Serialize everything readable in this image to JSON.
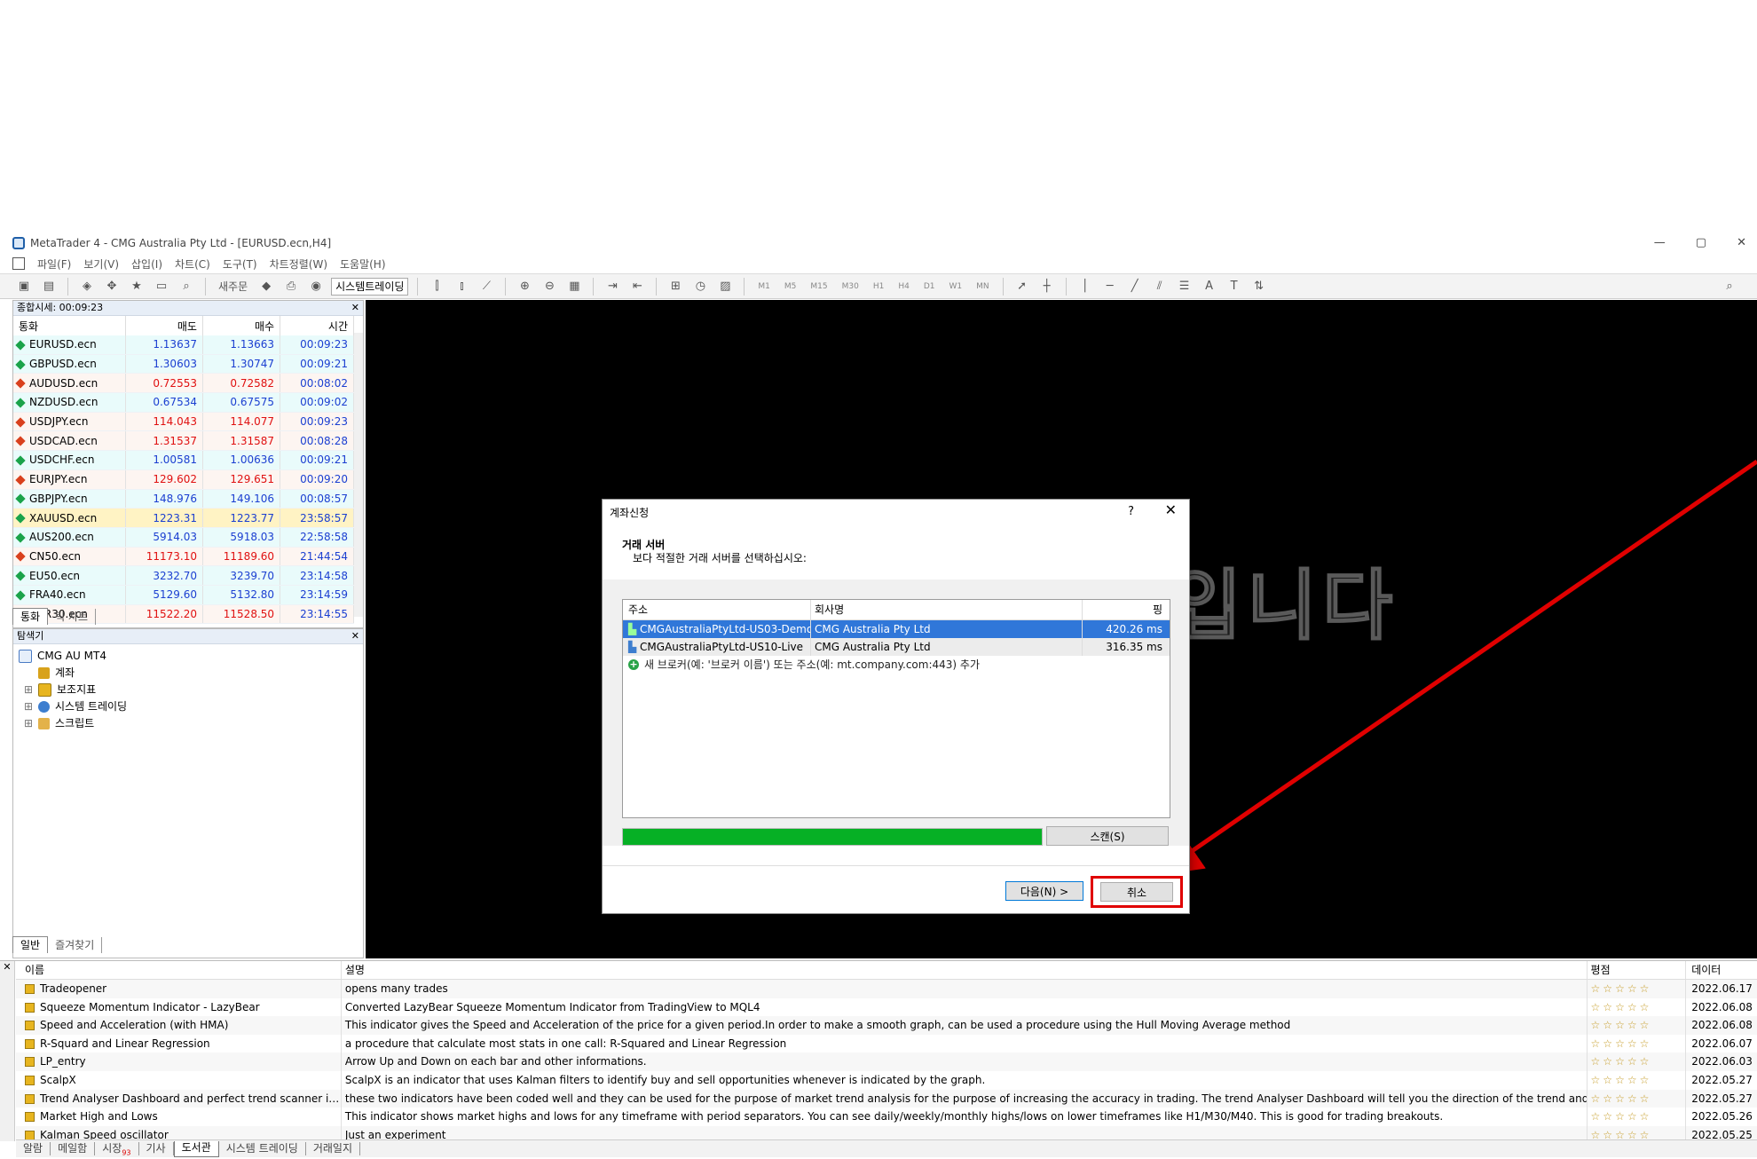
{
  "window": {
    "title": "MetaTrader 4 - CMG Australia Pty Ltd - [EURUSD.ecn,H4]",
    "controls": [
      "—",
      "▢",
      "✕"
    ]
  },
  "menu": [
    "파일(F)",
    "보기(V)",
    "삽입(I)",
    "차트(C)",
    "도구(T)",
    "차트정렬(W)",
    "도움말(H)"
  ],
  "toolbar": {
    "new_order": "새주문",
    "auto_trading": "시스템트레이딩",
    "timeframes": [
      "M1",
      "M5",
      "M15",
      "M30",
      "H1",
      "H4",
      "D1",
      "W1",
      "MN"
    ]
  },
  "market_watch": {
    "header": "종합시세: 00:09:23",
    "columns": [
      "통화",
      "매도",
      "매수",
      "시간"
    ],
    "rows": [
      {
        "symbol": "EURUSD.ecn",
        "bid": "1.13637",
        "ask": "1.13663",
        "time": "00:09:23",
        "dir": "up"
      },
      {
        "symbol": "GBPUSD.ecn",
        "bid": "1.30603",
        "ask": "1.30747",
        "time": "00:09:21",
        "dir": "up"
      },
      {
        "symbol": "AUDUSD.ecn",
        "bid": "0.72553",
        "ask": "0.72582",
        "time": "00:08:02",
        "dir": "down"
      },
      {
        "symbol": "NZDUSD.ecn",
        "bid": "0.67534",
        "ask": "0.67575",
        "time": "00:09:02",
        "dir": "up"
      },
      {
        "symbol": "USDJPY.ecn",
        "bid": "114.043",
        "ask": "114.077",
        "time": "00:09:23",
        "dir": "down"
      },
      {
        "symbol": "USDCAD.ecn",
        "bid": "1.31537",
        "ask": "1.31587",
        "time": "00:08:28",
        "dir": "down"
      },
      {
        "symbol": "USDCHF.ecn",
        "bid": "1.00581",
        "ask": "1.00636",
        "time": "00:09:21",
        "dir": "up"
      },
      {
        "symbol": "EURJPY.ecn",
        "bid": "129.602",
        "ask": "129.651",
        "time": "00:09:20",
        "dir": "down"
      },
      {
        "symbol": "GBPJPY.ecn",
        "bid": "148.976",
        "ask": "149.106",
        "time": "00:08:57",
        "dir": "up"
      },
      {
        "symbol": "XAUUSD.ecn",
        "bid": "1223.31",
        "ask": "1223.77",
        "time": "23:58:57",
        "dir": "hl"
      },
      {
        "symbol": "AUS200.ecn",
        "bid": "5914.03",
        "ask": "5918.03",
        "time": "22:58:58",
        "dir": "up"
      },
      {
        "symbol": "CN50.ecn",
        "bid": "11173.10",
        "ask": "11189.60",
        "time": "21:44:54",
        "dir": "down"
      },
      {
        "symbol": "EU50.ecn",
        "bid": "3232.70",
        "ask": "3239.70",
        "time": "23:14:58",
        "dir": "up"
      },
      {
        "symbol": "FRA40.ecn",
        "bid": "5129.60",
        "ask": "5132.80",
        "time": "23:14:59",
        "dir": "up"
      },
      {
        "symbol": "GER30.ecn",
        "bid": "11522.20",
        "ask": "11528.50",
        "time": "23:14:55",
        "dir": "down"
      }
    ],
    "tabs": [
      "통화",
      "틱 차트"
    ]
  },
  "navigator": {
    "header": "탐색기",
    "items": [
      "CMG AU MT4",
      "계좌",
      "보조지표",
      "시스템 트레이딩",
      "스크립트"
    ],
    "tabs": [
      "일반",
      "즐겨찾기"
    ]
  },
  "chart": {
    "watermark": "입니다"
  },
  "dialog": {
    "title": "계좌신청",
    "help": "?",
    "close": "✕",
    "heading": "거래 서버",
    "subheading": "보다 적절한 거래 서버를 선택하십시오:",
    "columns": [
      "주소",
      "회사명",
      "핑"
    ],
    "servers": [
      {
        "address": "CMGAustraliaPtyLtd-US03-Demo",
        "company": "CMG Australia Pty Ltd",
        "ping": "420.26 ms"
      },
      {
        "address": "CMGAustraliaPtyLtd-US10-Live",
        "company": "CMG Australia Pty Ltd",
        "ping": "316.35 ms"
      }
    ],
    "add_broker": "새 브로커(예: '브로커 이름') 또는 주소(예: mt.company.com:443) 추가",
    "progress": 1.0,
    "scan_label": "스캔(S)",
    "next_label": "다음(N) >",
    "cancel_label": "취소"
  },
  "library": {
    "columns": [
      "이름",
      "설명",
      "평점",
      "데이터"
    ],
    "rows": [
      {
        "name": "Tradeopener",
        "desc": "opens many trades",
        "rating": "☆☆☆☆☆",
        "date": "2022.06.17"
      },
      {
        "name": "Squeeze Momentum Indicator - LazyBear",
        "desc": "Converted LazyBear Squeeze Momentum Indicator from TradingView to MQL4",
        "rating": "☆☆☆☆☆",
        "date": "2022.06.08"
      },
      {
        "name": "Speed and Acceleration (with HMA)",
        "desc": "This indicator gives the Speed and Acceleration of the price for a given period.In order to make a smooth graph, can be used a procedure using the Hull Moving Average method",
        "rating": "☆☆☆☆☆",
        "date": "2022.06.08"
      },
      {
        "name": "R-Squard and Linear Regression",
        "desc": "a procedure that calculate most stats in one call: R-Squared and Linear Regression",
        "rating": "☆☆☆☆☆",
        "date": "2022.06.07"
      },
      {
        "name": "LP_entry",
        "desc": "Arrow Up and Down on each bar and other informations.",
        "rating": "☆☆☆☆☆",
        "date": "2022.06.03"
      },
      {
        "name": "ScalpX",
        "desc": "ScalpX is an indicator that uses Kalman filters to identify buy and sell opportunities whenever is indicated by the graph.",
        "rating": "☆☆☆☆☆",
        "date": "2022.05.27"
      },
      {
        "name": "Trend Analyser Dashboard and perfect trend scanner indi...",
        "desc": "these two indicators have been coded well and they can be used for the purpose of market trend analysis for the purpose of increasing the accuracy in trading. The trend Analyser Dashboard will tell you the direction of the trend and whether to trade",
        "rating": "☆☆☆☆☆",
        "date": "2022.05.27"
      },
      {
        "name": "Market High and Lows",
        "desc": "This indicator shows market highs and lows for any timeframe with period separators. You can see daily/weekly/monthly highs/lows on lower timeframes like H1/M30/M40. This is good for trading breakouts.",
        "rating": "☆☆☆☆☆",
        "date": "2022.05.26"
      },
      {
        "name": "Kalman Speed oscillator",
        "desc": "Just an experiment",
        "rating": "☆☆☆☆☆",
        "date": "2022.05.25"
      }
    ]
  },
  "bottom_tabs": [
    "알람",
    "메일함",
    "시장",
    "기사",
    "도서관",
    "시스템 트레이딩",
    "거래일지"
  ],
  "market_badge": "93",
  "colors": {
    "accent_red": "#e00000",
    "selection": "#3077d9",
    "progress": "#06b025",
    "price_up": "#1b3fd1",
    "price_down": "#e01010"
  }
}
